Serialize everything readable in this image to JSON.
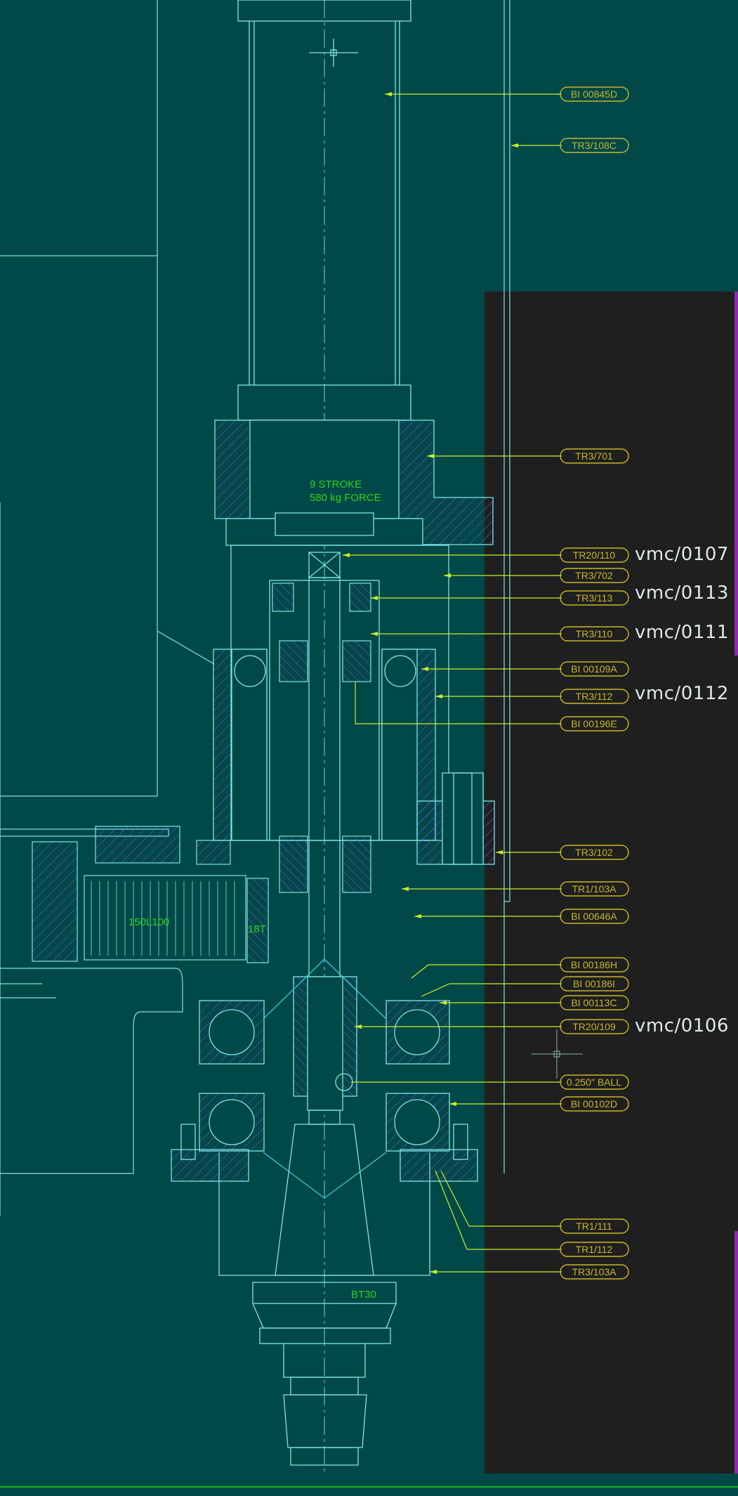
{
  "drawing": {
    "stroke_color": "#7fe6e6",
    "center_color": "#39c9d9",
    "hatch_color": "#7a4fd6",
    "leader_color": "#c8ef28",
    "callout_color": "#c7b62a",
    "text_green": "#2fd41c",
    "annotations": {
      "stroke": "9 STROKE",
      "force": "580 kg FORCE",
      "gear": "150L100",
      "teeth": "18T",
      "taper": "BT30"
    }
  },
  "callouts": [
    {
      "label": "BI 00845D"
    },
    {
      "label": "TR3/108C"
    },
    {
      "label": "TR3/701"
    },
    {
      "label": "TR20/110"
    },
    {
      "label": "TR3/702"
    },
    {
      "label": "TR3/113"
    },
    {
      "label": "TR3/110"
    },
    {
      "label": "BI 00109A"
    },
    {
      "label": "TR3/112"
    },
    {
      "label": "BI 00196E"
    },
    {
      "label": "TR3/102"
    },
    {
      "label": "TR1/103A"
    },
    {
      "label": "BI 00646A"
    },
    {
      "label": "BI 00186H"
    },
    {
      "label": "BI 00186I"
    },
    {
      "label": "BI 00113C"
    },
    {
      "label": "TR20/109"
    },
    {
      "label": "0.250\" BALL"
    },
    {
      "label": "BI 00102D"
    },
    {
      "label": "TR1/111"
    },
    {
      "label": "TR1/112"
    },
    {
      "label": "TR3/103A"
    }
  ],
  "notes": [
    {
      "text": "vmc/0107"
    },
    {
      "text": "vmc/0113"
    },
    {
      "text": "vmc/0111"
    },
    {
      "text": "vmc/0112"
    },
    {
      "text": "vmc/0106"
    }
  ]
}
